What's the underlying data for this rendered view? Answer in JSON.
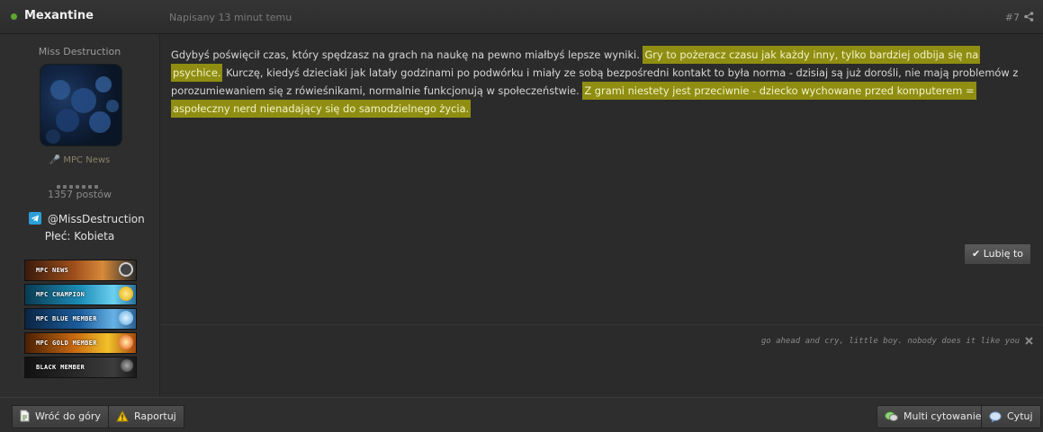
{
  "header": {
    "author": "Mexantine",
    "posted": "Napisany 13 minut temu",
    "post_number": "#7"
  },
  "profile": {
    "rank_title": "Miss Destruction",
    "group": "MPC News",
    "post_count": "1357 postów",
    "telegram": "@MissDestruction",
    "gender": "Płeć: Kobieta",
    "rank_pips": 7,
    "badges": [
      "MPC NEWS",
      "MPC CHAMPION",
      "MPC BLUE MEMBER",
      "MPC GOLD MEMBER",
      "BLACK MEMBER"
    ]
  },
  "post": {
    "p1": "Gdybyś poświęcił czas, który spędzasz na grach na naukę na pewno miałbyś lepsze wyniki. ",
    "h1": "Gry to pożeracz czasu jak każdy inny, tylko bardziej odbija się na psychice.",
    "p2": " Kurczę, kiedyś dzieciaki jak latały godzinami po podwórku i miały ze sobą bezpośredni kontakt to była norma - dzisiaj są już dorośli, nie mają problemów z porozumiewaniem się z rówieśnikami, normalnie funkcjonują w społeczeństwie. ",
    "h2": "Z grami niestety jest przeciwnie - dziecko wychowane przed komputerem = aspołeczny nerd nienadający się do samodzielnego życia.",
    "like_label": "✔ Lubię to",
    "signature": "go ahead and cry, little boy. nobody does it like you"
  },
  "footer": {
    "back_to_top": "Wróć do góry",
    "report": "Raportuj",
    "multiquote": "Multi cytowanie",
    "quote": "Cytuj"
  },
  "colors": {
    "highlight": "#8f8e12",
    "online": "#5fa62f",
    "background": "#2b2b2b"
  }
}
